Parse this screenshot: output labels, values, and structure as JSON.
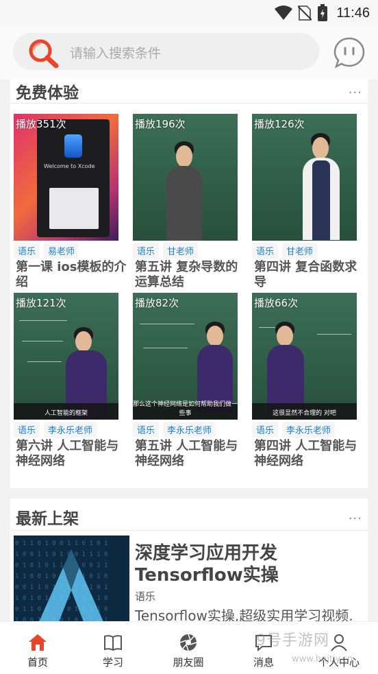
{
  "status_bar": {
    "time": "11:46"
  },
  "search": {
    "placeholder": "请输入搜索条件"
  },
  "free_section": {
    "title": "免费体验",
    "more": "...",
    "courses": [
      {
        "plays": "播放351次",
        "tags": [
          "语乐",
          "易老师"
        ],
        "title": "第一课 ios模板的介绍",
        "thumb_caption": ""
      },
      {
        "plays": "播放196次",
        "tags": [
          "语乐",
          "甘老师"
        ],
        "title": "第五讲 复杂导数的运算总结",
        "thumb_caption": ""
      },
      {
        "plays": "播放126次",
        "tags": [
          "语乐",
          "甘老师"
        ],
        "title": "第四讲 复合函数求导",
        "thumb_caption": ""
      },
      {
        "plays": "播放121次",
        "tags": [
          "语乐",
          "李永乐老师"
        ],
        "title": "第六讲 人工智能与神经网络",
        "thumb_caption": "人工智能的框架"
      },
      {
        "plays": "播放82次",
        "tags": [
          "语乐",
          "李永乐老师"
        ],
        "title": "第五讲 人工智能与神经网络",
        "thumb_caption": "那么这个神经网络是如何帮助我们做一些事"
      },
      {
        "plays": "播放66次",
        "tags": [
          "语乐",
          "李永乐老师"
        ],
        "title": "第四讲 人工智能与神经网络",
        "thumb_caption": "这很显然不合理的 对吧"
      }
    ]
  },
  "new_section": {
    "title": "最新上架",
    "more": "...",
    "item": {
      "title": "深度学习应用开发Tensorflow实操",
      "tag": "语乐",
      "description": "Tensorflow实操,超级实用学习视频."
    }
  },
  "bottom_nav": [
    {
      "label": "首页",
      "icon": "home-icon",
      "active": true
    },
    {
      "label": "学习",
      "icon": "book-icon",
      "active": false
    },
    {
      "label": "朋友圈",
      "icon": "aperture-icon",
      "active": false
    },
    {
      "label": "消息",
      "icon": "message-icon",
      "active": false
    },
    {
      "label": "个人中心",
      "icon": "user-icon",
      "active": false
    }
  ],
  "watermark": {
    "text": "9号手游网",
    "url": "www.hnjtjy.cn"
  },
  "colors": {
    "accent": "#e8452a",
    "tag_text": "#1a7fd8",
    "background": "#f2f2f2"
  }
}
